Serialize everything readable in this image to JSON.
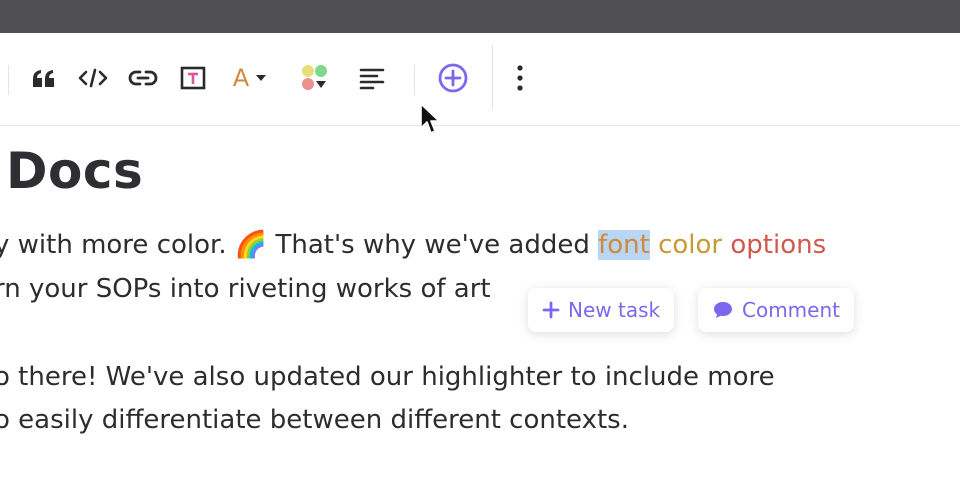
{
  "toolbar": {
    "text_color_letter": "A",
    "icons": [
      "quote-icon",
      "code-icon",
      "link-icon",
      "text-style-icon",
      "text-color-icon",
      "highlight-color-icon",
      "align-icon",
      "add-icon",
      "more-icon"
    ]
  },
  "colors": {
    "accent": "#7b68ee",
    "text_orange": "#d08a3a",
    "text_gold": "#c69a34",
    "text_red": "#d2584f",
    "highlight": "#b9d6f5"
  },
  "document": {
    "title": "Docs",
    "p1_line1_before": "y with more color. 🌈  That's why we've added ",
    "p1_word_font": "font",
    "p1_word_color": "color",
    "p1_word_options": "options",
    "p1_line2": "rn your SOPs into riveting works of art",
    "p2_line1": "o there! We've also updated our highlighter to include more",
    "p2_line2": "o easily differentiate between different contexts."
  },
  "selection_menu": {
    "new_task_label": "New task",
    "comment_label": "Comment"
  }
}
